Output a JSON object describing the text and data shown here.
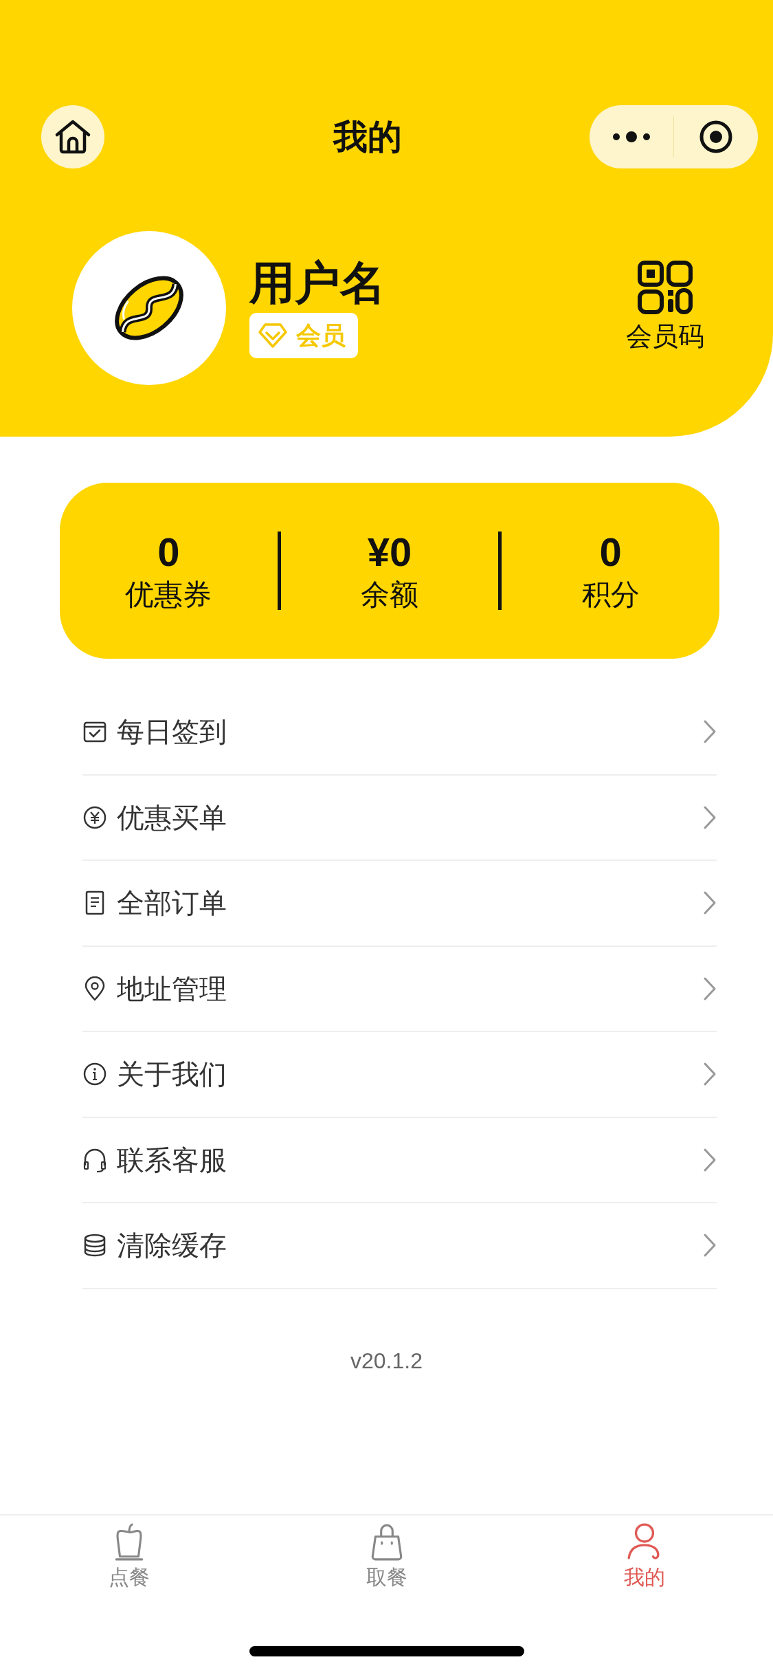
{
  "nav_bar": {
    "title": "我的"
  },
  "profile": {
    "username": "用户名",
    "member_badge": "会员",
    "member_code_label": "会员码"
  },
  "stats": [
    {
      "value": "0",
      "label": "优惠券"
    },
    {
      "value": "¥0",
      "label": "余额"
    },
    {
      "value": "0",
      "label": "积分"
    }
  ],
  "menu": [
    {
      "label": "每日签到"
    },
    {
      "label": "优惠买单"
    },
    {
      "label": "全部订单"
    },
    {
      "label": "地址管理"
    },
    {
      "label": "关于我们"
    },
    {
      "label": "联系客服"
    },
    {
      "label": "清除缓存"
    }
  ],
  "version": "v20.1.2",
  "tab_bar": [
    {
      "label": "点餐",
      "selected": false
    },
    {
      "label": "取餐",
      "selected": false
    },
    {
      "label": "我的",
      "selected": true
    }
  ]
}
